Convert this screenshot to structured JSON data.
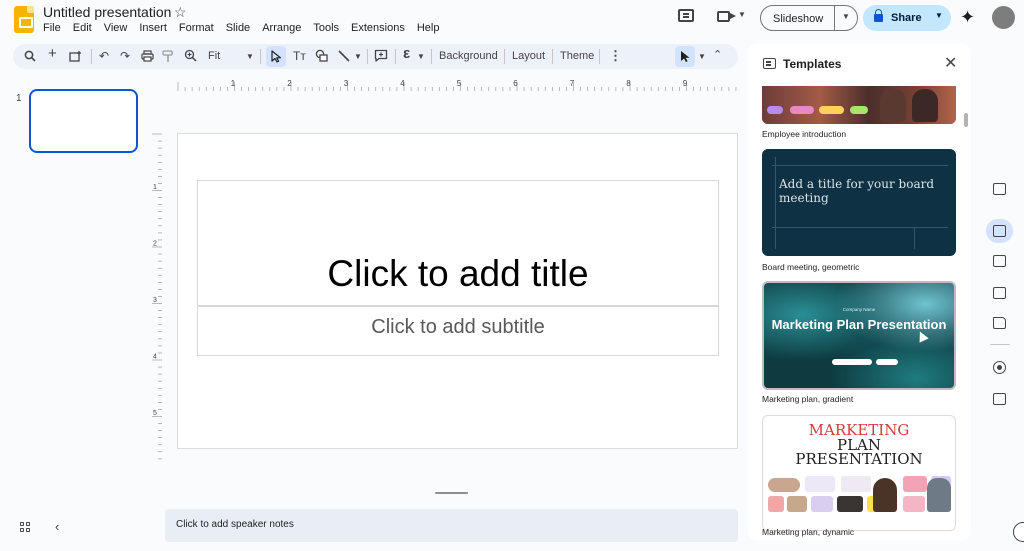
{
  "app": {
    "title": "Untitled presentation"
  },
  "menu": [
    "File",
    "Edit",
    "View",
    "Insert",
    "Format",
    "Slide",
    "Arrange",
    "Tools",
    "Extensions",
    "Help"
  ],
  "header": {
    "slideshow_label": "Slideshow",
    "share_label": "Share"
  },
  "toolbar": {
    "zoom": "Fit",
    "background": "Background",
    "layout": "Layout",
    "theme": "Theme"
  },
  "filmstrip": {
    "slide_number": "1"
  },
  "ruler": {
    "h_labels": [
      "1",
      "2",
      "3",
      "4",
      "5",
      "6",
      "7",
      "8",
      "9"
    ],
    "v_labels": [
      "1",
      "2",
      "3",
      "4",
      "5"
    ]
  },
  "slide": {
    "title_placeholder": "Click to add title",
    "subtitle_placeholder": "Click to add subtitle"
  },
  "notes": {
    "placeholder": "Click to add speaker notes"
  },
  "templates": {
    "title": "Templates",
    "items": [
      {
        "label": "Employee introduction"
      },
      {
        "label": "Board meeting, geometric",
        "card_title": "Add a title for your board meeting"
      },
      {
        "label": "Marketing plan, gradient",
        "card_company": "Company Name",
        "card_title": "Marketing Plan Presentation"
      },
      {
        "label": "Marketing plan, dynamic",
        "card_line1": "MARKETING",
        "card_line2": "PLAN",
        "card_line3": "PRESENTATION"
      }
    ]
  },
  "colors": {
    "accent": "#0b57d0",
    "share_bg": "#c2e7ff",
    "toolbar_bg": "#edf2fa",
    "logo": "#f4b400"
  }
}
